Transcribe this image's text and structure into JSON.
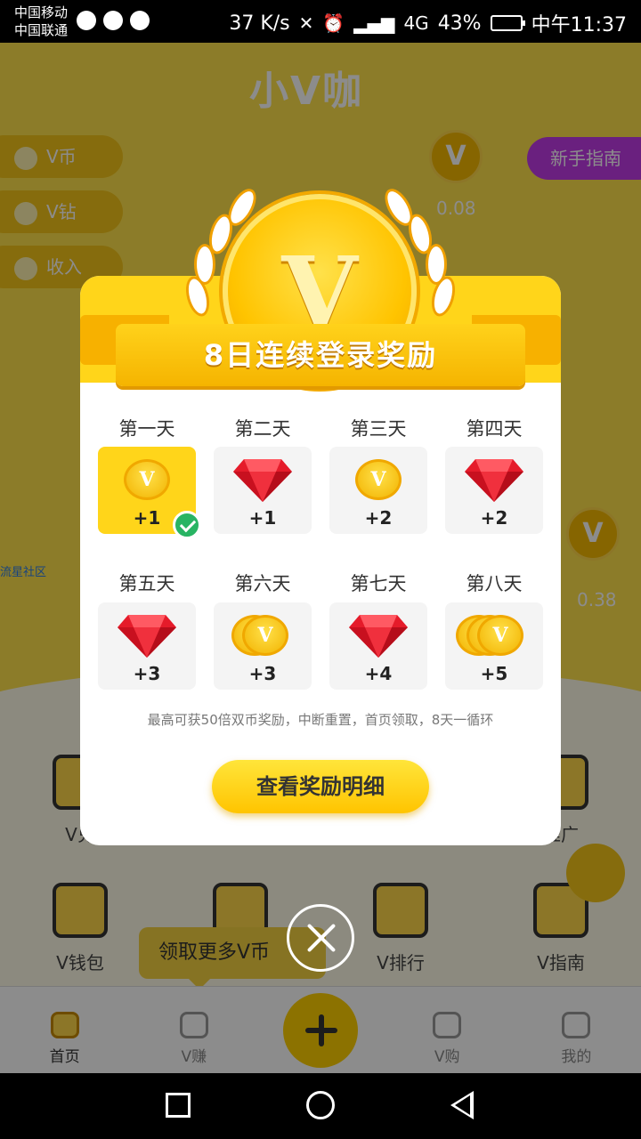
{
  "status_bar": {
    "carrier_1": "中国移动",
    "carrier_2": "中国联通",
    "speed": "37 K/s",
    "network": "4G",
    "battery": "43%",
    "time": "中午11:37"
  },
  "app": {
    "title": "小V咖",
    "side_pills": [
      "V币",
      "V钻",
      "收入"
    ],
    "guide_button": "新手指南",
    "floating_values": [
      "0.08",
      "0.38"
    ],
    "side_link": "流星社区",
    "grid_row_1": [
      "V兑",
      "",
      "",
      "推广"
    ],
    "grid_row_2": [
      "V钱包",
      "",
      "V排行",
      "V指南"
    ],
    "tip_bubble": "领取更多V币",
    "tabs": [
      {
        "label": "首页",
        "active": true
      },
      {
        "label": "V赚",
        "active": false
      },
      {
        "label": "V购",
        "active": false
      },
      {
        "label": "我的",
        "active": false
      }
    ]
  },
  "modal": {
    "title": "8日连续登录奖励",
    "days": [
      {
        "label": "第一天",
        "reward": "coin",
        "amount": "+1",
        "claimed": true
      },
      {
        "label": "第二天",
        "reward": "gem",
        "amount": "+1",
        "claimed": false
      },
      {
        "label": "第三天",
        "reward": "coin",
        "amount": "+2",
        "claimed": false
      },
      {
        "label": "第四天",
        "reward": "gem",
        "amount": "+2",
        "claimed": false
      },
      {
        "label": "第五天",
        "reward": "gem",
        "amount": "+3",
        "claimed": false
      },
      {
        "label": "第六天",
        "reward": "coins-2",
        "amount": "+3",
        "claimed": false
      },
      {
        "label": "第七天",
        "reward": "gem",
        "amount": "+4",
        "claimed": false
      },
      {
        "label": "第八天",
        "reward": "coins-3",
        "amount": "+5",
        "claimed": false
      }
    ],
    "note": "最高可获50倍双币奖励，中断重置，首页领取，8天一循环",
    "detail_button": "查看奖励明细",
    "coin_letter": "V"
  },
  "colors": {
    "brand_yellow": "#ffd51a",
    "gem_red": "#e51b2a",
    "check_green": "#28b463"
  }
}
